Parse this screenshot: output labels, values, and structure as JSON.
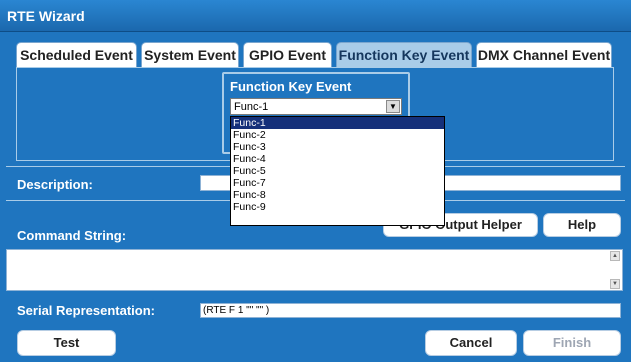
{
  "window": {
    "title": "RTE Wizard"
  },
  "tabs": [
    {
      "label": "Scheduled Event"
    },
    {
      "label": "System Event"
    },
    {
      "label": "GPIO Event"
    },
    {
      "label": "Function Key Event"
    },
    {
      "label": "DMX Channel Event"
    }
  ],
  "active_tab": "Function Key Event",
  "function_key": {
    "group_title": "Function Key Event",
    "selected": "Func-1",
    "options": [
      "Func-1",
      "Func-2",
      "Func-3",
      "Func-4",
      "Func-5",
      "Func-7",
      "Func-8",
      "Func-9"
    ]
  },
  "description": {
    "label": "Description:",
    "value": ""
  },
  "command": {
    "label": "Command String:",
    "value": "",
    "gpio_helper_button": "GPIO Output Helper",
    "help_button": "Help"
  },
  "serial": {
    "label": "Serial Representation:",
    "value": "(RTE F 1 \"\" \"\" )"
  },
  "footer": {
    "test_button": "Test",
    "cancel_button": "Cancel",
    "finish_button": "Finish"
  },
  "icons": {
    "dropdown_arrow": "chevron-down-icon",
    "scroll_up": "arrow-up-icon",
    "scroll_down": "arrow-down-icon"
  }
}
